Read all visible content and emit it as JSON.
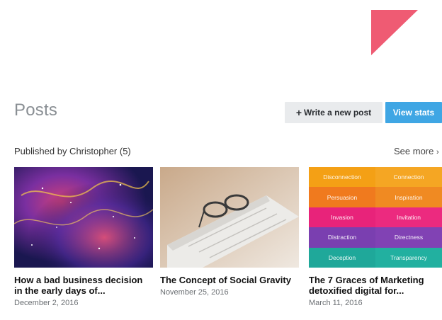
{
  "colors": {
    "accent_flag": "#ef5b73",
    "stats_button": "#3fa6e4",
    "write_button": "#e9ebed"
  },
  "header": {
    "title": "Posts",
    "write_button": {
      "icon": "plus-icon",
      "label": "Write a new post"
    },
    "stats_button": {
      "label": "View stats"
    }
  },
  "section": {
    "published_by": "Published by Christopher (5)",
    "see_more": "See more",
    "see_more_icon": "chevron-right-icon"
  },
  "posts": [
    {
      "image": "galaxy-nebula-image",
      "title": "How a bad business decision in the early days of...",
      "date": "December 2, 2016"
    },
    {
      "image": "glasses-on-newspaper-image",
      "title": "The Concept of Social Gravity",
      "date": "November 25, 2016"
    },
    {
      "image": "word-tiles-image",
      "title": "The 7 Graces of Marketing detoxified digital for...",
      "date": "March 11, 2016",
      "tiles": [
        {
          "text": "Disconnection",
          "color": "#f4a015"
        },
        {
          "text": "Connection",
          "color": "#f5a623"
        },
        {
          "text": "Persuasion",
          "color": "#f07a1e"
        },
        {
          "text": "Inspiration",
          "color": "#f08a22"
        },
        {
          "text": "Invasion",
          "color": "#e8237a"
        },
        {
          "text": "Invitation",
          "color": "#ec2a7f"
        },
        {
          "text": "Distraction",
          "color": "#7a3fb0"
        },
        {
          "text": "Directness",
          "color": "#8142b4"
        },
        {
          "text": "Deception",
          "color": "#1fa89a"
        },
        {
          "text": "Transparency",
          "color": "#22b0a0"
        }
      ]
    }
  ]
}
